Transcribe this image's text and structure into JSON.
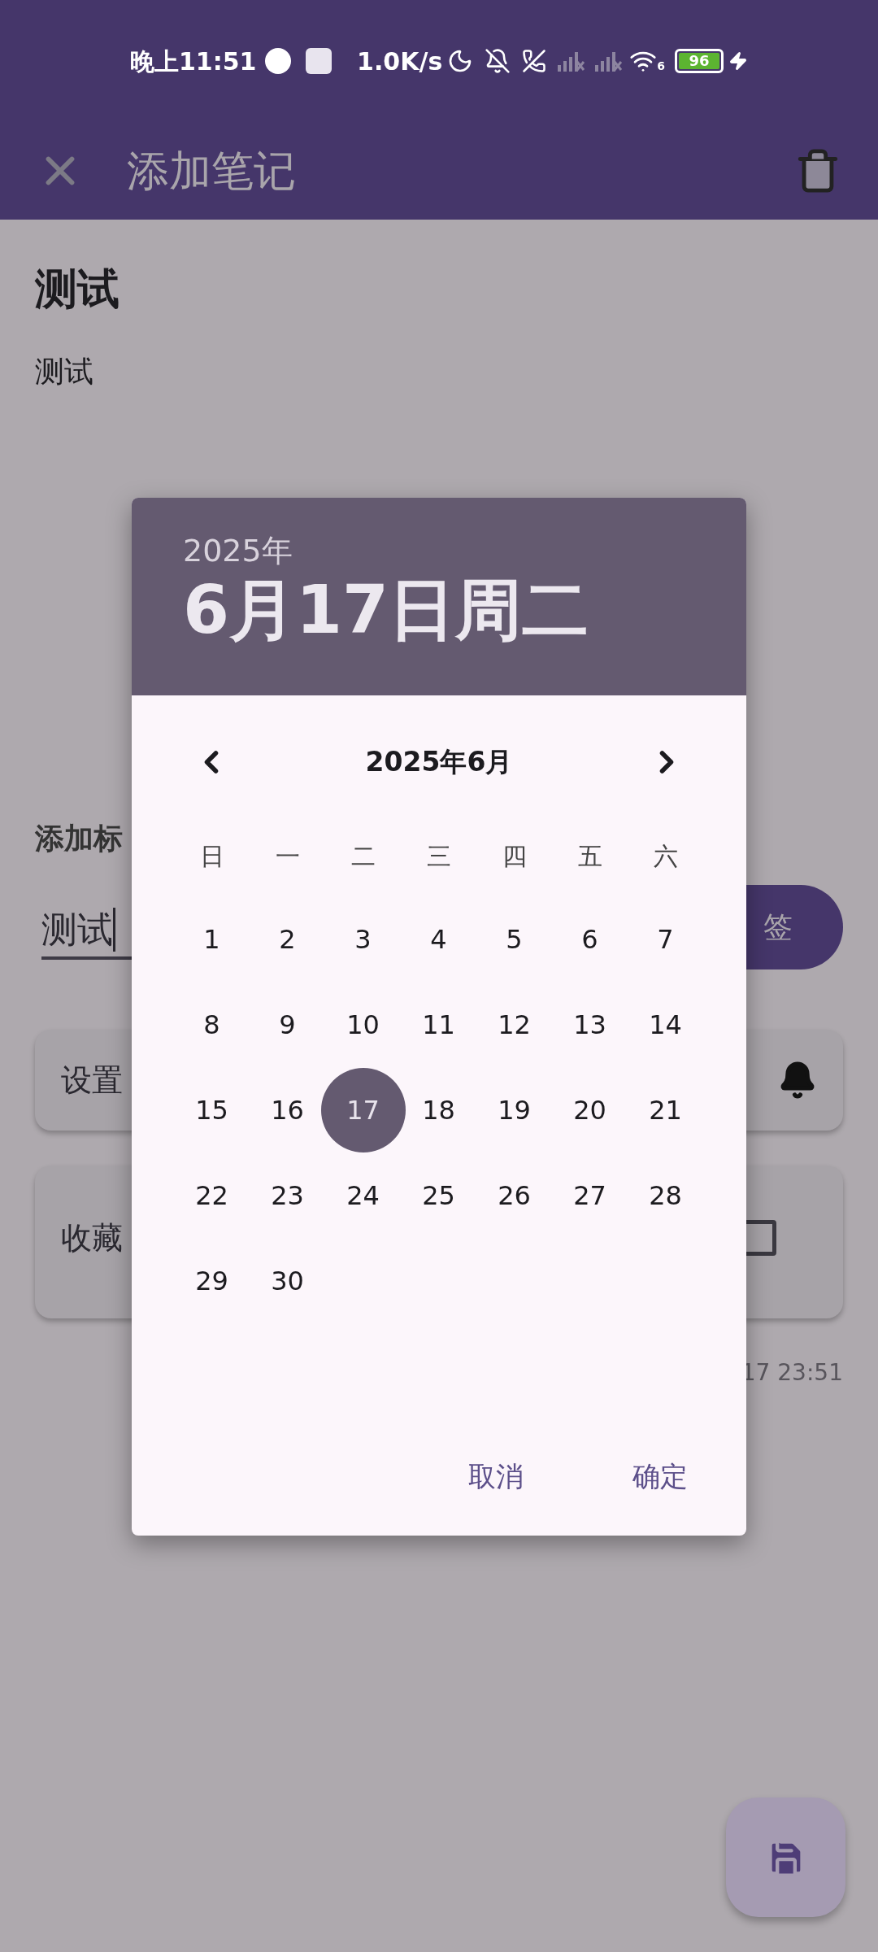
{
  "status_bar": {
    "time": "晚上11:51",
    "net_speed": "1.0K/s",
    "wifi_badge": "6",
    "battery": "96"
  },
  "app_bar": {
    "title": "添加笔记"
  },
  "note": {
    "title": "测试",
    "body": "测试"
  },
  "tag_section": {
    "label": "添加标",
    "input_value": "测试",
    "button_label": "签"
  },
  "reminder_card": {
    "label": "设置"
  },
  "favorite_card": {
    "label": "收藏",
    "checked": false
  },
  "timestamp": "17 23:51",
  "date_picker": {
    "header_year": "2025年",
    "header_date": "6月17日周二",
    "month_label": "2025年6月",
    "weekdays": [
      "日",
      "一",
      "二",
      "三",
      "四",
      "五",
      "六"
    ],
    "days": [
      {
        "label": "1",
        "selected": false
      },
      {
        "label": "2",
        "selected": false
      },
      {
        "label": "3",
        "selected": false
      },
      {
        "label": "4",
        "selected": false
      },
      {
        "label": "5",
        "selected": false
      },
      {
        "label": "6",
        "selected": false
      },
      {
        "label": "7",
        "selected": false
      },
      {
        "label": "8",
        "selected": false
      },
      {
        "label": "9",
        "selected": false
      },
      {
        "label": "10",
        "selected": false
      },
      {
        "label": "11",
        "selected": false
      },
      {
        "label": "12",
        "selected": false
      },
      {
        "label": "13",
        "selected": false
      },
      {
        "label": "14",
        "selected": false
      },
      {
        "label": "15",
        "selected": false
      },
      {
        "label": "16",
        "selected": false
      },
      {
        "label": "17",
        "selected": true
      },
      {
        "label": "18",
        "selected": false
      },
      {
        "label": "19",
        "selected": false
      },
      {
        "label": "20",
        "selected": false
      },
      {
        "label": "21",
        "selected": false
      },
      {
        "label": "22",
        "selected": false
      },
      {
        "label": "23",
        "selected": false
      },
      {
        "label": "24",
        "selected": false
      },
      {
        "label": "25",
        "selected": false
      },
      {
        "label": "26",
        "selected": false
      },
      {
        "label": "27",
        "selected": false
      },
      {
        "label": "28",
        "selected": false
      },
      {
        "label": "29",
        "selected": false
      },
      {
        "label": "30",
        "selected": false
      }
    ],
    "buttons": [
      "取消",
      "确定"
    ]
  }
}
